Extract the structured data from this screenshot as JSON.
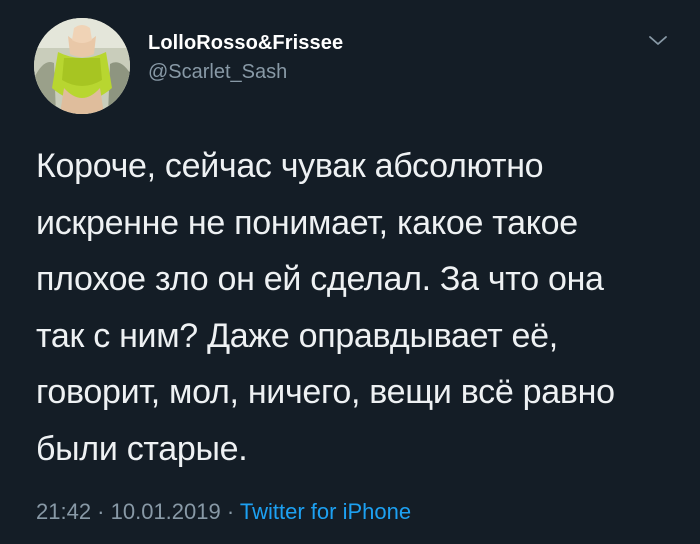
{
  "tweet": {
    "display_name": "LolloRosso&Frissee",
    "handle": "@Scarlet_Sash",
    "text_lines": [
      "Короче, сейчас чувак абсолютно",
      "искренне не понимает, какое такое",
      "плохое зло он ей сделал. За что она",
      "так с ним? Даже оправдывает её,",
      "говорит, мол, ничего, вещи всё равно",
      "были старые."
    ],
    "time": "21:42",
    "separator": " · ",
    "date": "10.01.2019",
    "source": "Twitter for iPhone"
  },
  "icons": {
    "menu": "chevron-down-icon"
  },
  "colors": {
    "background": "#141d26",
    "text": "#eef1f3",
    "secondary": "#8899a6",
    "link": "#1da1f2"
  }
}
